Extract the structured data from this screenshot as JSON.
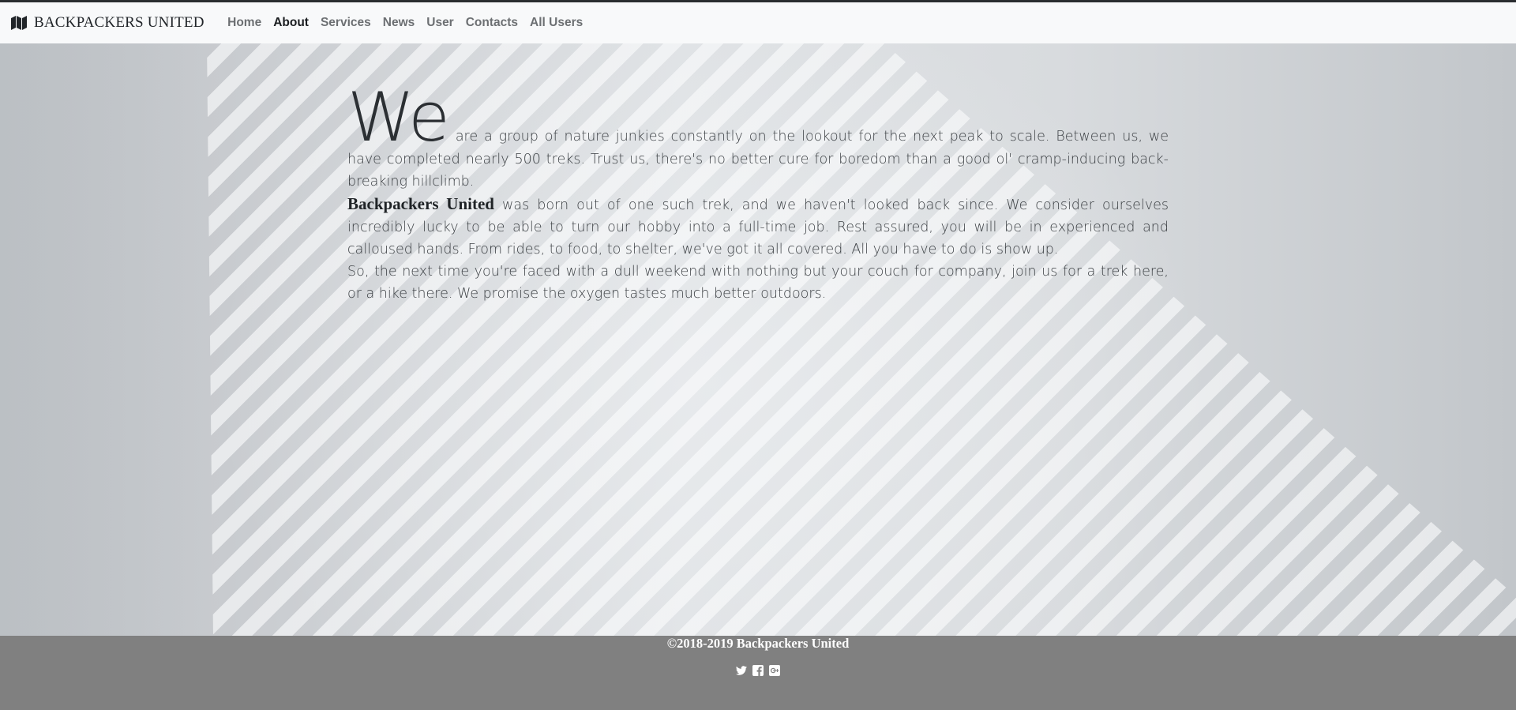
{
  "brand": {
    "icon": "map-icon",
    "name": "BACKPACKERS UNITED"
  },
  "nav": [
    {
      "label": "Home",
      "active": false
    },
    {
      "label": "About",
      "active": true
    },
    {
      "label": "Services",
      "active": false
    },
    {
      "label": "News",
      "active": false
    },
    {
      "label": "User",
      "active": false
    },
    {
      "label": "Contacts",
      "active": false
    },
    {
      "label": "All Users",
      "active": false
    }
  ],
  "about": {
    "drop_word": "We",
    "p1_rest": "are a group of nature junkies constantly on the lookout for the next peak to scale. Between us, we have completed nearly 500 treks. Trust us, there's no better cure for boredom than a good ol' cramp-inducing back-breaking hillclimb.",
    "company_name": "Backpackers United",
    "p2_rest": "was born out of one such trek, and we haven't looked back since. We consider ourselves incredibly lucky to be able to turn our hobby into a full-time job. Rest assured, you will be in experienced and calloused hands. From rides, to food, to shelter, we've got it all covered. All you have to do is show up.",
    "p3": "So, the next time you're faced with a dull weekend with nothing but your couch for company, join us for a trek here, or a hike there. We promise the oxygen tastes much better outdoors."
  },
  "footer": {
    "copyright": "©2018-2019 Backpackers United",
    "social_icons": [
      "twitter-icon",
      "facebook-icon",
      "google-plus-icon"
    ]
  },
  "colors": {
    "navbar_bg": "#f8f9fa",
    "footer_bg": "#808080",
    "active_nav": "#1a1d20",
    "nav_text": "#6c6f72"
  }
}
